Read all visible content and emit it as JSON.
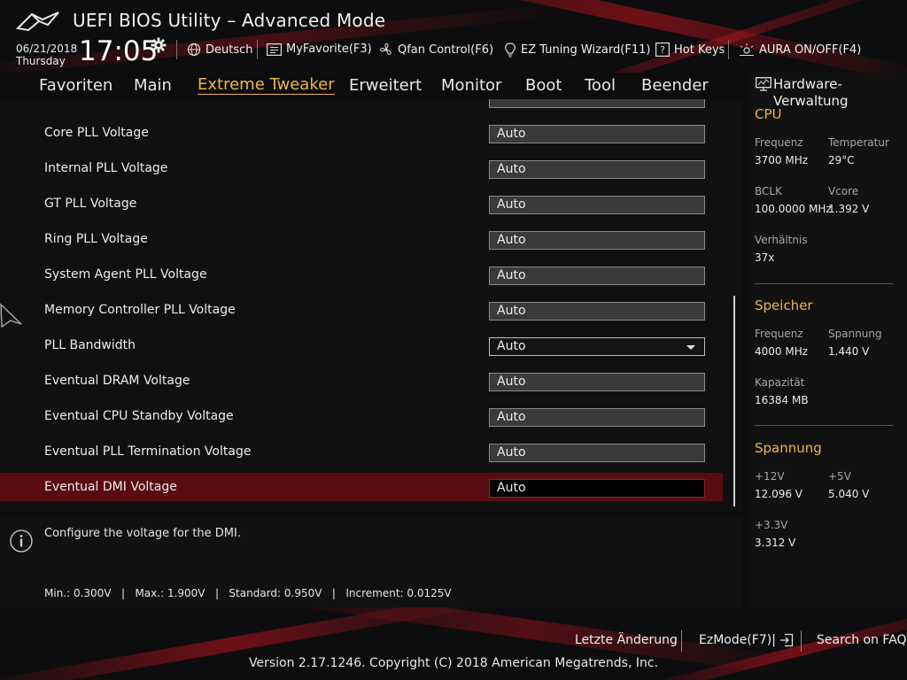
{
  "header": {
    "title": "UEFI BIOS Utility – Advanced Mode",
    "date": "06/21/2018",
    "weekday": "Thursday",
    "time": "17:05",
    "items": [
      {
        "label": "Deutsch",
        "icon": "globe-icon"
      },
      {
        "label": "MyFavorite(F3)",
        "icon": "favorite-list-icon"
      },
      {
        "label": "Qfan Control(F6)",
        "icon": "fan-icon"
      },
      {
        "label": "EZ Tuning Wizard(F11)",
        "icon": "lightbulb-icon"
      },
      {
        "label": "Hot Keys",
        "icon": "question-icon"
      },
      {
        "label": "AURA ON/OFF(F4)",
        "icon": "aura-icon"
      }
    ]
  },
  "nav": {
    "tabs": [
      "Favoriten",
      "Main",
      "Extreme Tweaker",
      "Erweitert",
      "Monitor",
      "Boot",
      "Tool",
      "Beender"
    ],
    "active": "Extreme Tweaker"
  },
  "settings": [
    {
      "label": "Core PLL Voltage",
      "value": "Auto"
    },
    {
      "label": "Internal PLL Voltage",
      "value": "Auto"
    },
    {
      "label": "GT PLL Voltage",
      "value": "Auto"
    },
    {
      "label": "Ring PLL Voltage",
      "value": "Auto"
    },
    {
      "label": "System Agent PLL Voltage",
      "value": "Auto"
    },
    {
      "label": "Memory Controller PLL Voltage",
      "value": "Auto"
    },
    {
      "label": "PLL Bandwidth",
      "value": "Auto"
    },
    {
      "label": "Eventual DRAM Voltage",
      "value": "Auto"
    },
    {
      "label": "Eventual CPU Standby Voltage",
      "value": "Auto"
    },
    {
      "label": "Eventual PLL Termination Voltage",
      "value": "Auto"
    },
    {
      "label": "Eventual DMI Voltage",
      "value": "Auto"
    }
  ],
  "info": {
    "description": "Configure the voltage for the DMI.",
    "range": "Min.: 0.300V   |   Max.: 1.900V   |   Standard: 0.950V   |   Increment: 0.0125V"
  },
  "hardware": {
    "title": "Hardware-Verwaltung",
    "cpu": {
      "heading": "CPU",
      "freq_label": "Frequenz",
      "freq": "3700 MHz",
      "temp_label": "Temperatur",
      "temp": "29°C",
      "bclk_label": "BCLK",
      "bclk": "100.0000 MHz",
      "vcore_label": "Vcore",
      "vcore": "1.392 V",
      "ratio_label": "Verhältnis",
      "ratio": "37x"
    },
    "memory": {
      "heading": "Speicher",
      "freq_label": "Frequenz",
      "freq": "4000 MHz",
      "volt_label": "Spannung",
      "volt": "1.440 V",
      "cap_label": "Kapazität",
      "cap": "16384 MB"
    },
    "voltage": {
      "heading": "Spannung",
      "v12_label": "+12V",
      "v12": "12.096 V",
      "v5_label": "+5V",
      "v5": "5.040 V",
      "v33_label": "+3.3V",
      "v33": "3.312 V"
    }
  },
  "footer": {
    "last_change": "Letzte Änderung",
    "ezmode": "EzMode(F7)|",
    "faq": "Search on FAQ",
    "version": "Version 2.17.1246. Copyright (C) 2018 American Megatrends, Inc."
  },
  "colors": {
    "accent": "#f0b44a",
    "selected_row": "#5a0c10",
    "brand_red": "#c0141e"
  }
}
